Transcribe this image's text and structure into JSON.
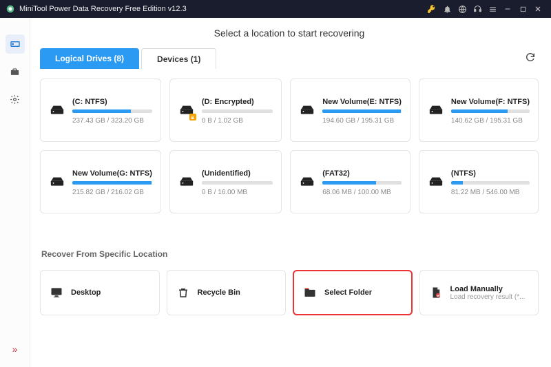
{
  "titlebar": {
    "title": "MiniTool Power Data Recovery Free Edition v12.3"
  },
  "header": {
    "text": "Select a location to start recovering"
  },
  "tabs": {
    "logical": "Logical Drives (8)",
    "devices": "Devices (1)"
  },
  "drives": [
    {
      "name": "(C: NTFS)",
      "size": "237.43 GB / 323.20 GB",
      "fill": 73,
      "locked": false
    },
    {
      "name": "(D: Encrypted)",
      "size": "0 B / 1.02 GB",
      "fill": 0,
      "locked": true
    },
    {
      "name": "New Volume(E: NTFS)",
      "size": "194.60 GB / 195.31 GB",
      "fill": 99,
      "locked": false
    },
    {
      "name": "New Volume(F: NTFS)",
      "size": "140.62 GB / 195.31 GB",
      "fill": 72,
      "locked": false
    },
    {
      "name": "New Volume(G: NTFS)",
      "size": "215.82 GB / 216.02 GB",
      "fill": 99,
      "locked": false
    },
    {
      "name": "(Unidentified)",
      "size": "0 B / 16.00 MB",
      "fill": 0,
      "locked": false
    },
    {
      "name": "(FAT32)",
      "size": "68.06 MB / 100.00 MB",
      "fill": 68,
      "locked": false
    },
    {
      "name": "(NTFS)",
      "size": "81.22 MB / 546.00 MB",
      "fill": 15,
      "locked": false
    }
  ],
  "section": {
    "title": "Recover From Specific Location"
  },
  "locations": {
    "desktop": {
      "label": "Desktop"
    },
    "recycle": {
      "label": "Recycle Bin"
    },
    "folder": {
      "label": "Select Folder"
    },
    "manual": {
      "label": "Load Manually",
      "sub": "Load recovery result (*..."
    }
  }
}
